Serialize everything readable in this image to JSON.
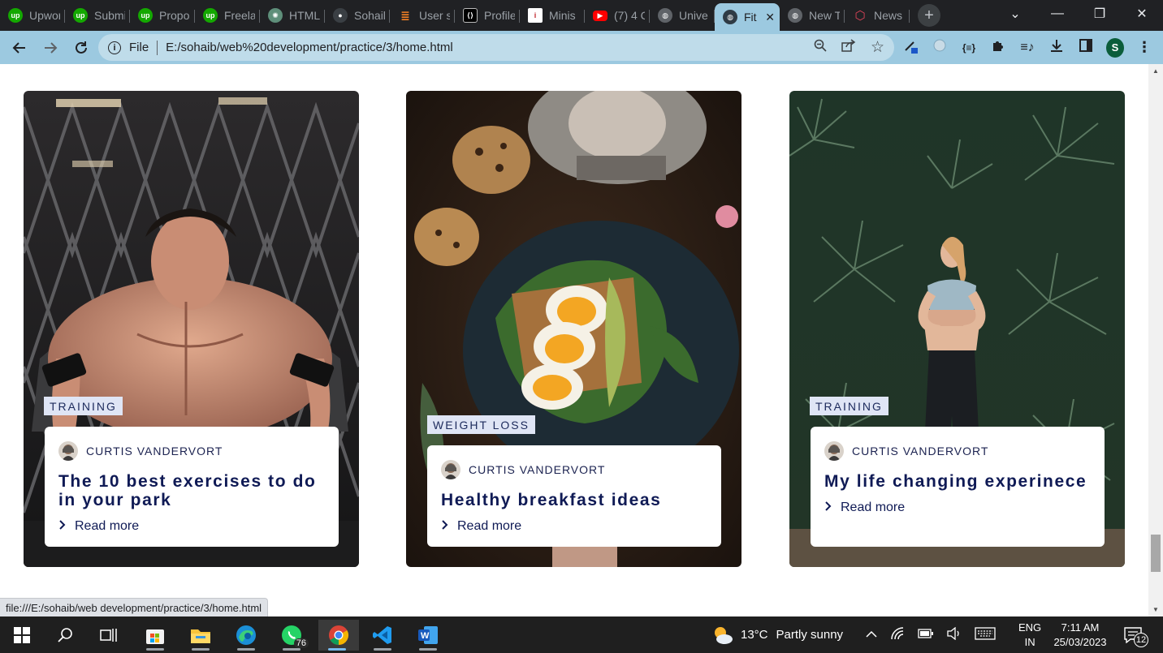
{
  "browser": {
    "tabs": [
      {
        "label": "Upwork",
        "favicon": "upwork-icon",
        "color": "#14a800"
      },
      {
        "label": "Submit",
        "favicon": "upwork-icon",
        "color": "#14a800"
      },
      {
        "label": "Proposal",
        "favicon": "upwork-icon",
        "color": "#14a800"
      },
      {
        "label": "Freelance",
        "favicon": "upwork-icon",
        "color": "#14a800"
      },
      {
        "label": "HTML",
        "favicon": "chatgpt-icon",
        "color": "#5e8f7a"
      },
      {
        "label": "Sohail",
        "favicon": "github-icon",
        "color": "#24292e"
      },
      {
        "label": "User s",
        "favicon": "stackoverflow-icon",
        "color": "#f48024"
      },
      {
        "label": "Profile",
        "favicon": "devto-icon",
        "color": "#000000"
      },
      {
        "label": "Minis",
        "favicon": "info-icon",
        "color": "#c0272d"
      },
      {
        "label": "(7) 4 C",
        "favicon": "youtube-icon",
        "color": "#ff0000"
      },
      {
        "label": "Unive",
        "favicon": "globe-icon",
        "color": "#444444"
      }
    ],
    "active_tab": {
      "label": "Fit",
      "favicon": "globe-icon"
    },
    "after_tabs": [
      {
        "label": "New T",
        "favicon": "chrome-icon",
        "color": "#444444"
      },
      {
        "label": "News",
        "favicon": "news-icon",
        "color": "#e0445a"
      }
    ],
    "new_tab_glyph": "+",
    "address": {
      "scheme": "File",
      "url": "E:/sohaib/web%20development/practice/3/home.html"
    },
    "profile_initial": "S",
    "status_url": "file:///E:/sohaib/web development/practice/3/home.html",
    "accent": "#9cc9e0"
  },
  "cards": [
    {
      "tag": "TRAINING",
      "author": "CURTIS VANDERVORT",
      "title": "The 10 best exercises to do in your park",
      "read_more": "Read more",
      "image": "man-training-photo"
    },
    {
      "tag": "WEIGHT LOSS",
      "author": "CURTIS VANDERVORT",
      "title": "Healthy breakfast ideas",
      "read_more": "Read more",
      "image": "breakfast-photo"
    },
    {
      "tag": "TRAINING",
      "author": "CURTIS VANDERVORT",
      "title": "My life changing experinece",
      "read_more": "Read more",
      "image": "woman-plants-photo"
    }
  ],
  "taskbar": {
    "whatsapp_badge": "76",
    "weather": {
      "temp": "13°C",
      "condition": "Partly sunny"
    },
    "language": {
      "lang": "ENG",
      "region": "IN"
    },
    "time": "7:11 AM",
    "date": "25/03/2023",
    "notifications": "12"
  }
}
